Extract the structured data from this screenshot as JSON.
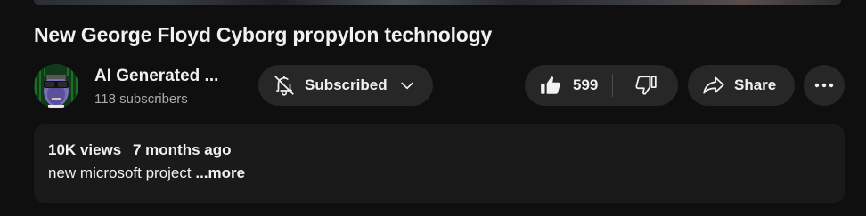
{
  "video": {
    "title": "New George Floyd Cyborg propylon technology"
  },
  "channel": {
    "name": "AI Generated ...",
    "subscribers": "118 subscribers",
    "avatar_icon": "cyborg-face-avatar"
  },
  "actions": {
    "subscribe_label": "Subscribed",
    "like_count": "599",
    "share_label": "Share"
  },
  "description": {
    "views": "10K views",
    "age": "7 months ago",
    "text": "new microsoft project ",
    "more_label": "...more"
  },
  "colors": {
    "background": "#0f0f0f",
    "pill": "#272727",
    "description_bg": "#1a1a1a",
    "secondary_text": "#aaaaaa"
  }
}
